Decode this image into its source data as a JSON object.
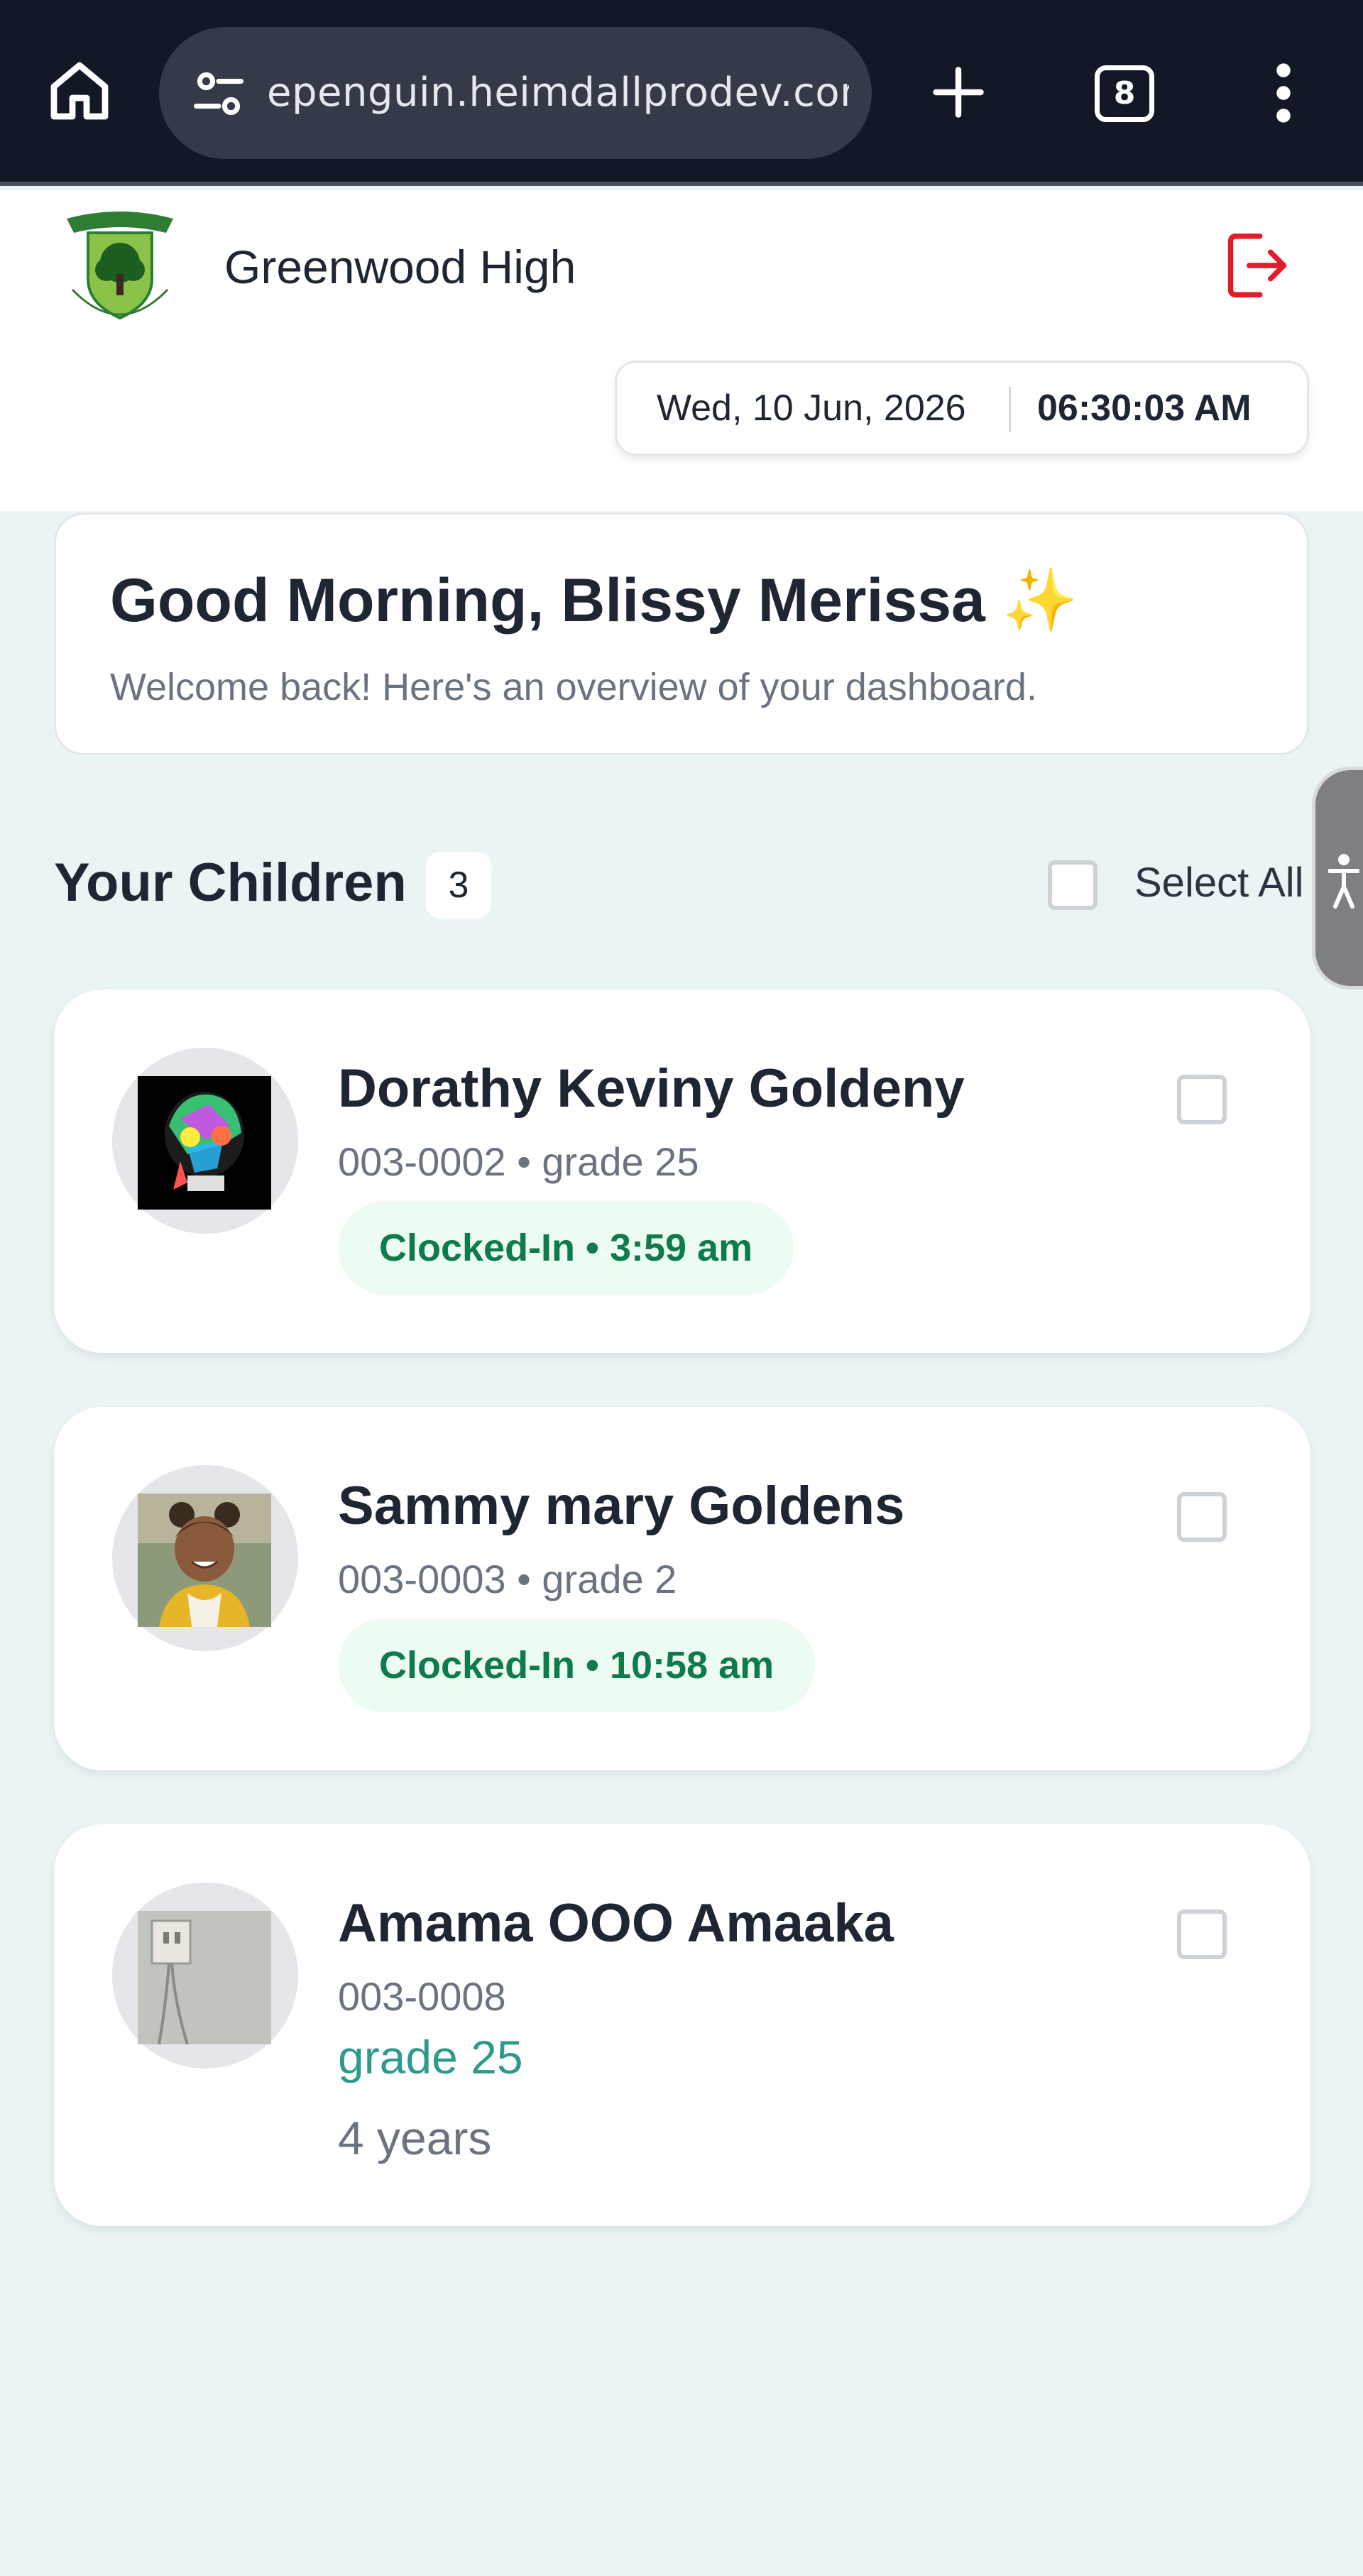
{
  "browser": {
    "url": "epenguin.heimdallprodev.com",
    "tab_count": "8"
  },
  "header": {
    "school_name": "Greenwood High",
    "date": "Wed, 10 Jun, 2026",
    "time": "06:30:03 AM"
  },
  "greeting": {
    "title": "Good Morning, Blissy Merissa",
    "emoji": "✨",
    "subtitle": "Welcome back! Here's an overview of your dashboard."
  },
  "children_section": {
    "title": "Your Children",
    "count": "3",
    "select_all_label": "Select All"
  },
  "children": [
    {
      "name": "Dorathy Keviny Goldeny",
      "meta": "003-0002 • grade 25",
      "status": "Clocked-In • 3:59 am"
    },
    {
      "name": "Sammy mary Goldens",
      "meta": "003-0003 • grade 2",
      "status": "Clocked-In • 10:58 am"
    },
    {
      "name": "Amama OOO Amaaka",
      "meta": "003-0008",
      "grade": "grade 25",
      "age": "4 years"
    }
  ],
  "colors": {
    "background": "#eaf4f4",
    "status_green": "#0f7a4a",
    "status_bg": "#ecfcf3",
    "logout_red": "#e11d2a",
    "grade_teal": "#2e9a8c"
  }
}
